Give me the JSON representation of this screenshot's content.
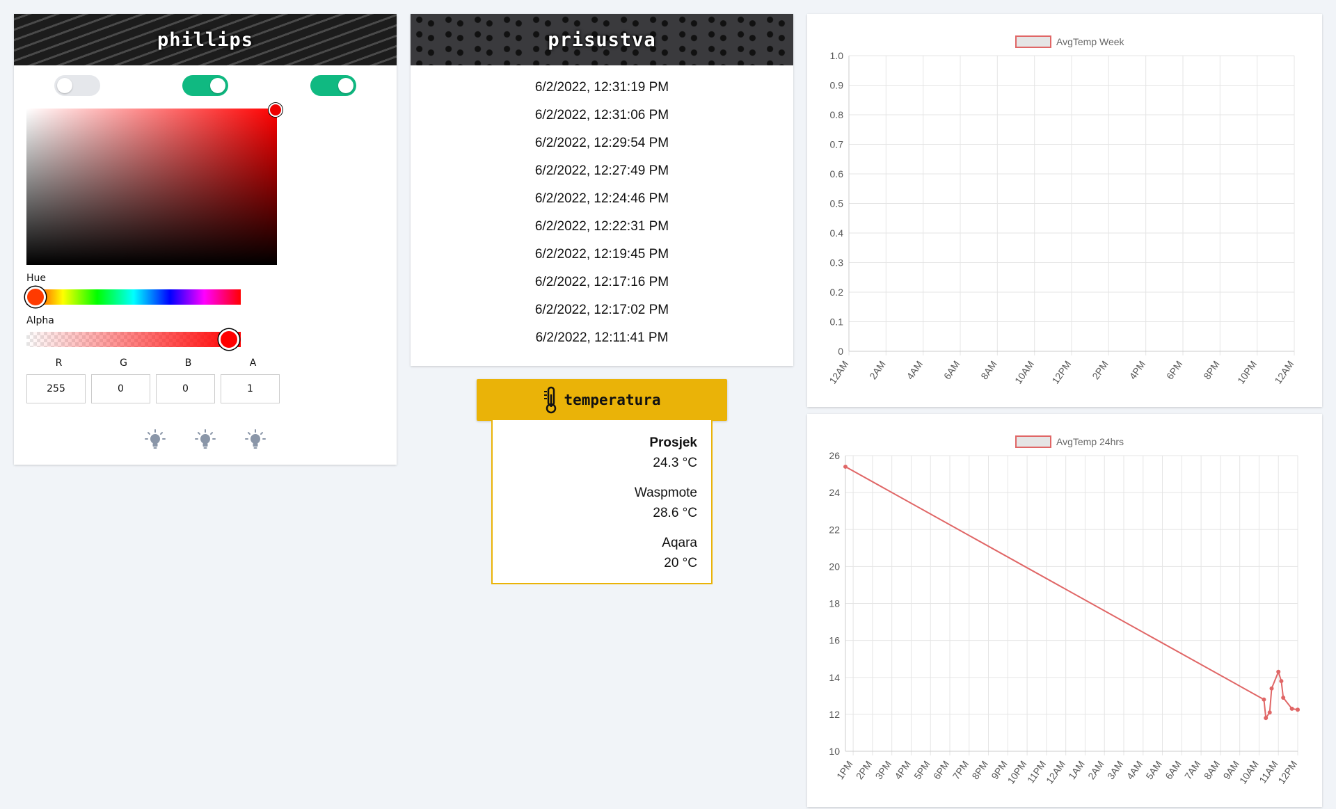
{
  "phillips": {
    "title": "phillips",
    "toggles": [
      {
        "name": "toggle-1",
        "on": false
      },
      {
        "name": "toggle-2",
        "on": true
      },
      {
        "name": "toggle-3",
        "on": true
      }
    ],
    "color_picker": {
      "hue_label": "Hue",
      "alpha_label": "Alpha",
      "labels": {
        "r": "R",
        "g": "G",
        "b": "B",
        "a": "A"
      },
      "values": {
        "r": "255",
        "g": "0",
        "b": "0",
        "a": "1"
      },
      "hue": 0,
      "alpha": 1
    },
    "bulbs": [
      "lightbulb-icon",
      "lightbulb-icon",
      "lightbulb-icon"
    ]
  },
  "prisustva": {
    "title": "prisustva",
    "times": [
      "6/2/2022, 12:31:19 PM",
      "6/2/2022, 12:31:06 PM",
      "6/2/2022, 12:29:54 PM",
      "6/2/2022, 12:27:49 PM",
      "6/2/2022, 12:24:46 PM",
      "6/2/2022, 12:22:31 PM",
      "6/2/2022, 12:19:45 PM",
      "6/2/2022, 12:17:16 PM",
      "6/2/2022, 12:17:02 PM",
      "6/2/2022, 12:11:41 PM"
    ]
  },
  "temperatura": {
    "title": "temperatura",
    "icon": "thermometer-icon",
    "readings": [
      {
        "label": "Prosjek",
        "value": "24.3 °C"
      },
      {
        "label": "Waspmote",
        "value": "28.6 °C"
      },
      {
        "label": "Aqara",
        "value": "20 °C"
      }
    ]
  },
  "colors": {
    "toggle_on": "#10b981",
    "toggle_off": "#e5e7eb",
    "accent": "#eab308",
    "line": "#e06666"
  },
  "chart_data": [
    {
      "type": "line",
      "legend": "AvgTemp Week",
      "legend_position": "top",
      "x_ticks": [
        "12AM",
        "2AM",
        "4AM",
        "6AM",
        "8AM",
        "10AM",
        "12PM",
        "2PM",
        "4PM",
        "6PM",
        "8PM",
        "10PM",
        "12AM"
      ],
      "y_ticks": [
        "0",
        "0.1",
        "0.2",
        "0.3",
        "0.4",
        "0.5",
        "0.6",
        "0.7",
        "0.8",
        "0.9",
        "1.0"
      ],
      "ylim": [
        0,
        1.0
      ],
      "grid": true,
      "series": [
        {
          "name": "AvgTemp Week",
          "points": []
        }
      ]
    },
    {
      "type": "line",
      "legend": "AvgTemp 24hrs",
      "legend_position": "top",
      "x_ticks": [
        "1PM",
        "2PM",
        "3PM",
        "4PM",
        "5PM",
        "6PM",
        "7PM",
        "8PM",
        "9PM",
        "10PM",
        "11PM",
        "12AM",
        "1AM",
        "2AM",
        "3AM",
        "4AM",
        "5AM",
        "6AM",
        "7AM",
        "8AM",
        "9AM",
        "10AM",
        "11AM",
        "12PM"
      ],
      "y_ticks": [
        "10",
        "12",
        "14",
        "16",
        "18",
        "20",
        "22",
        "24",
        "26"
      ],
      "ylim": [
        10,
        26
      ],
      "xlim": [
        12.6,
        36
      ],
      "grid": true,
      "series": [
        {
          "name": "AvgTemp 24hrs",
          "points": [
            {
              "x": 12.6,
              "y": 25.4
            },
            {
              "x": 34.25,
              "y": 12.8
            },
            {
              "x": 34.35,
              "y": 11.8
            },
            {
              "x": 34.55,
              "y": 12.1
            },
            {
              "x": 34.65,
              "y": 13.4
            },
            {
              "x": 35.0,
              "y": 14.3
            },
            {
              "x": 35.15,
              "y": 13.8
            },
            {
              "x": 35.25,
              "y": 12.9
            },
            {
              "x": 35.7,
              "y": 12.3
            },
            {
              "x": 36.0,
              "y": 12.25
            }
          ]
        }
      ]
    }
  ]
}
